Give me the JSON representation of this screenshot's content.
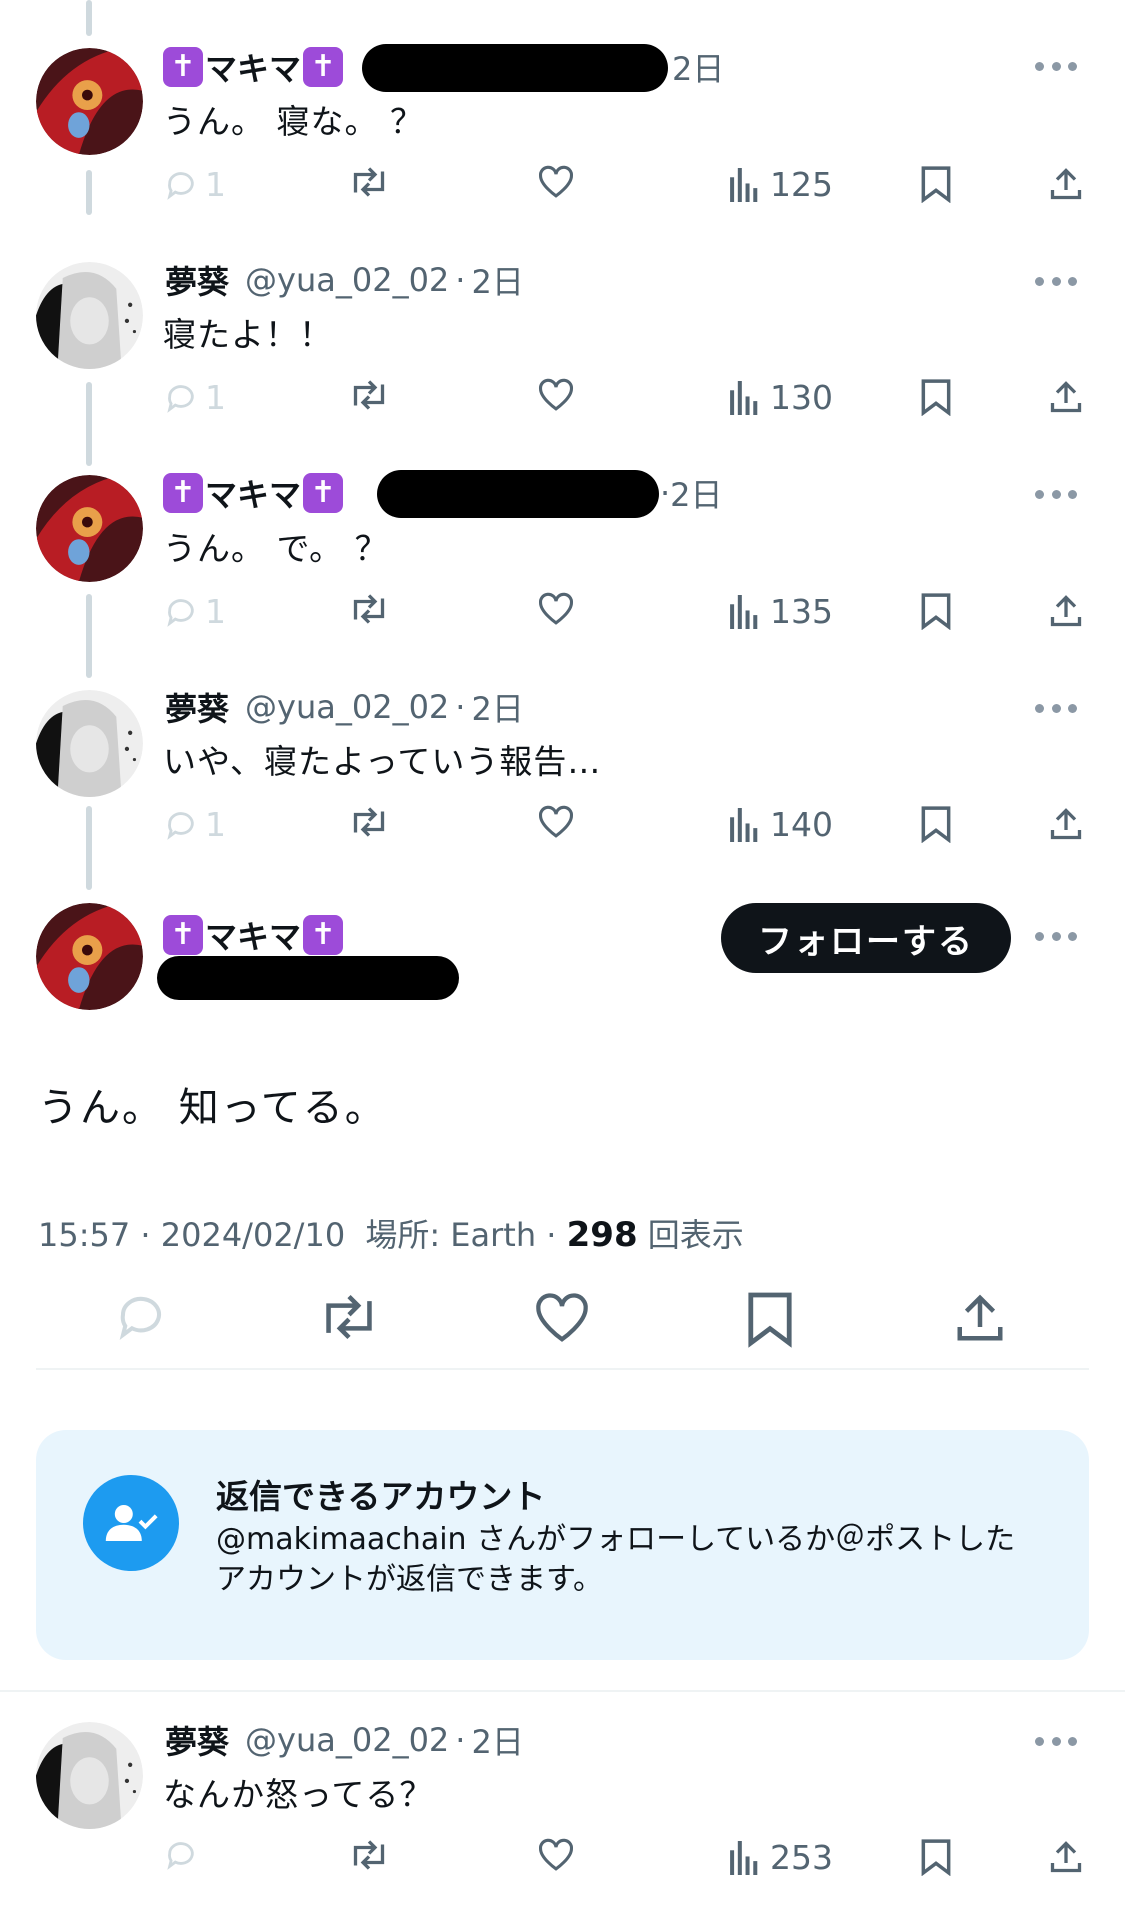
{
  "replies": [
    {
      "author": "マキマ",
      "handle": "",
      "time": "2日",
      "text": "うん。 寝な。 ？",
      "replies": "1",
      "views": "125"
    },
    {
      "author": "夢葵",
      "handle": "@yua_02_02",
      "time": "2日",
      "text": "寝たよ！！",
      "replies": "1",
      "views": "130"
    },
    {
      "author": "マキマ",
      "handle": "",
      "time": "2日",
      "text": "うん。 で。 ？",
      "replies": "1",
      "views": "135"
    },
    {
      "author": "夢葵",
      "handle": "@yua_02_02",
      "time": "2日",
      "text": "いや、寝たよっていう報告…",
      "replies": "1",
      "views": "140"
    }
  ],
  "sep": "·",
  "cross_glyph": "✝",
  "main_post": {
    "author": "マキマ",
    "follow_label": "フォローする",
    "text": "うん。 知ってる。",
    "timestamp": "15:57 · 2024/02/10",
    "location": "場所: Earth",
    "views": "298",
    "views_label": "回表示"
  },
  "reply_notice": {
    "title": "返信できるアカウント",
    "body": "@makimaachain さんがフォローしているか＠ポストしたアカウントが返信できます。"
  },
  "bottom_reply": {
    "author": "夢葵",
    "handle": "@yua_02_02",
    "time": "2日",
    "text": "なんか怒ってる？",
    "views": "253"
  },
  "colors": {
    "accent": "#1d9bf0",
    "text": "#0f1419",
    "muted": "#536471",
    "badge": "#9d4bd9",
    "notice_bg": "#e8f5fd"
  }
}
